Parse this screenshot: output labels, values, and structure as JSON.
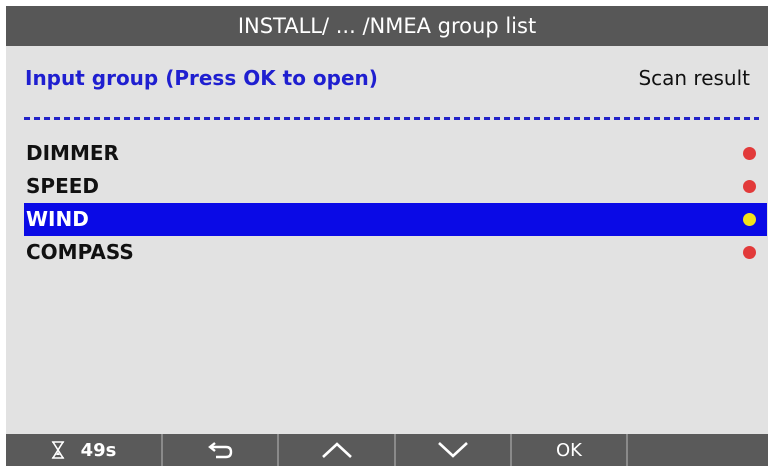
{
  "window": {
    "title": "INSTALL/ ... /NMEA group list"
  },
  "list": {
    "left_header": "Input group (Press OK to open)",
    "right_header": "Scan result",
    "items": [
      {
        "label": "DIMMER",
        "status_color": "#e23a3a",
        "selected": false
      },
      {
        "label": "SPEED",
        "status_color": "#e23a3a",
        "selected": false
      },
      {
        "label": "WIND",
        "status_color": "#f3e21a",
        "selected": true
      },
      {
        "label": "COMPASS",
        "status_color": "#e23a3a",
        "selected": false
      }
    ]
  },
  "toolbar": {
    "timer_icon": "hourglass-icon",
    "timer_value": "49s",
    "back_icon": "back-arrow-icon",
    "up_icon": "chevron-up-icon",
    "down_icon": "chevron-down-icon",
    "ok_label": "OK"
  },
  "colors": {
    "selection": "#0a0ae6",
    "header_text": "#1f1fd0",
    "titlebar": "#575757",
    "toolbar": "#5a5a5a"
  }
}
